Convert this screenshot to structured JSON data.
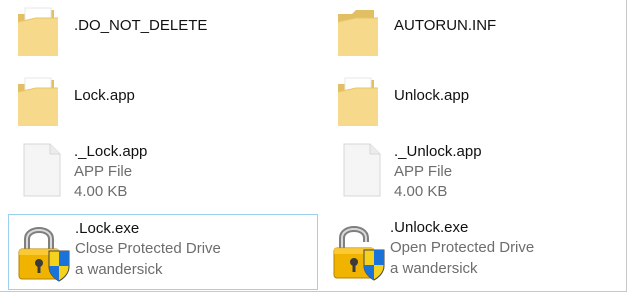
{
  "files": [
    {
      "name": ".DO_NOT_DELETE",
      "kind": "folder"
    },
    {
      "name": "AUTORUN.INF",
      "kind": "folder"
    },
    {
      "name": "Lock.app",
      "kind": "folder"
    },
    {
      "name": "Unlock.app",
      "kind": "folder"
    },
    {
      "name": "._Lock.app",
      "type": "APP File",
      "size": "4.00 KB",
      "kind": "document"
    },
    {
      "name": "._Unlock.app",
      "type": "APP File",
      "size": "4.00 KB",
      "kind": "document"
    },
    {
      "name": ".Lock.exe",
      "description": "Close Protected Drive",
      "company": "a wandersick",
      "kind": "exe-lock-closed"
    },
    {
      "name": ".Unlock.exe",
      "description": "Open Protected Drive",
      "company": "a wandersick",
      "kind": "exe-lock-open"
    }
  ],
  "colors": {
    "folder_back": "#e8c66b",
    "folder_front": "#f7dd8c",
    "folder_paper": "#ffffff",
    "doc_fill": "#f2f2f2",
    "doc_border": "#d7d7d7",
    "selection_border": "#9bd1ef",
    "lock_body": "#f0b400",
    "lock_shackle": "#8c8c8c",
    "shield_blue": "#1a73d8",
    "shield_yellow": "#f4d21d"
  }
}
